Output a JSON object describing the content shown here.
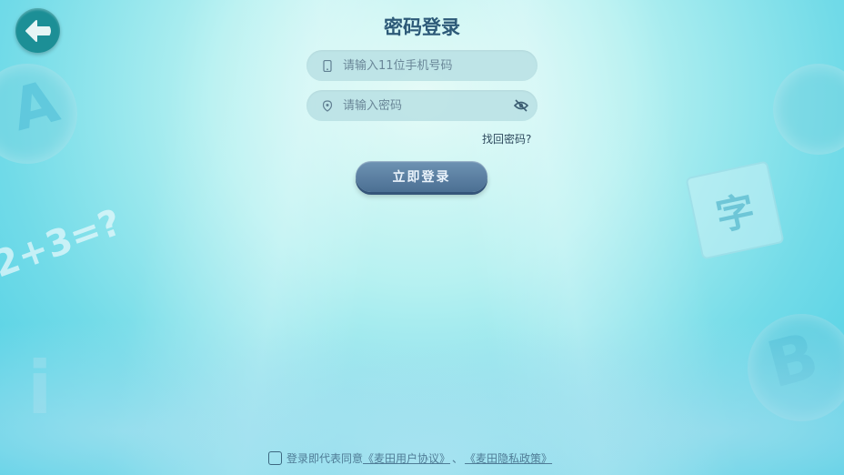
{
  "header": {
    "title": "密码登录",
    "back_icon": "arrow-left-icon"
  },
  "form": {
    "phone": {
      "placeholder": "请输入11位手机号码",
      "icon": "phone-icon",
      "value": ""
    },
    "password": {
      "placeholder": "请输入密码",
      "icon": "lock-icon",
      "value": "",
      "toggle_icon": "eye-off-icon"
    },
    "forgot_label": "找回密码?",
    "login_label": "立即登录"
  },
  "agreement": {
    "checked": false,
    "prefix": "登录即代表同意",
    "user_agreement": "《麦田用户协议》",
    "separator": "、",
    "privacy_policy": "《麦田隐私政策》"
  },
  "decorations": {
    "letter_a": "A",
    "letter_b": "B",
    "char_zi": "字",
    "equation": "2+3=?",
    "letter_i": "i"
  },
  "colors": {
    "accent": "#1c8f96",
    "button": "#4b6f93",
    "title": "#2d5a78"
  }
}
